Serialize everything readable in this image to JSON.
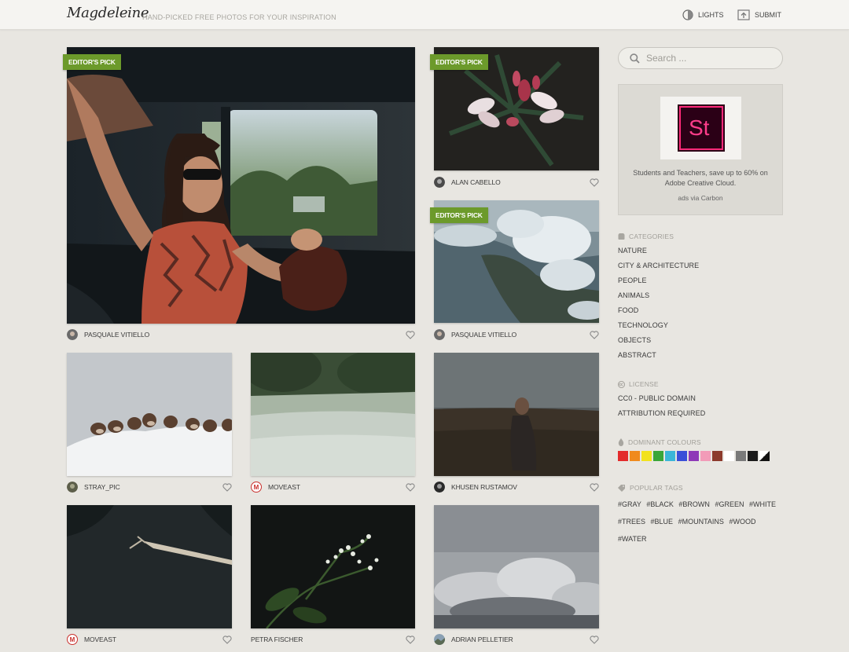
{
  "header": {
    "logo": "Magdeleine",
    "tagline": "HAND-PICKED FREE PHOTOS FOR YOUR INSPIRATION",
    "lights_label": "LIGHTS",
    "submit_label": "SUBMIT"
  },
  "photos": [
    {
      "author": "PASQUALE VITIELLO",
      "badge": "EDITOR'S PICK",
      "avatar": "photo-avatar"
    },
    {
      "author": "ALAN CABELLO",
      "badge": "EDITOR'S PICK",
      "avatar": "photo-avatar"
    },
    {
      "author": "PASQUALE VITIELLO",
      "badge": "EDITOR'S PICK",
      "avatar": "photo-avatar"
    },
    {
      "author": "STRAY_PIC",
      "avatar": "photo-avatar"
    },
    {
      "author": "MOVEAST",
      "avatar": "moveast-logo",
      "avatar_letter": "M"
    },
    {
      "author": "KHUSEN RUSTAMOV",
      "avatar": "photo-avatar"
    },
    {
      "author": "MOVEAST",
      "avatar": "moveast-logo",
      "avatar_letter": "M"
    },
    {
      "author": "PETRA FISCHER"
    },
    {
      "author": "ADRIAN PELLETIER",
      "avatar": "photo-avatar"
    }
  ],
  "sidebar": {
    "search_placeholder": "Search ...",
    "ad": {
      "logo_text": "St",
      "text": "Students and Teachers, save up to 60% on Adobe Creative Cloud.",
      "via": "ads via Carbon"
    },
    "categories": {
      "title": "CATEGORIES",
      "items": [
        "NATURE",
        "CITY & ARCHITECTURE",
        "PEOPLE",
        "ANIMALS",
        "FOOD",
        "TECHNOLOGY",
        "OBJECTS",
        "ABSTRACT"
      ]
    },
    "license": {
      "title": "LICENSE",
      "items": [
        "CC0 - PUBLIC DOMAIN",
        "ATTRIBUTION REQUIRED"
      ]
    },
    "colours": {
      "title": "DOMINANT COLOURS",
      "swatches": [
        "#e32b2b",
        "#f08a1c",
        "#f2e21e",
        "#3aa63a",
        "#3bb6d8",
        "#3a4fd8",
        "#8e3ab8",
        "#f29bb8",
        "#8c3a2c",
        "#ffffff",
        "#7a7a7a",
        "#1a1a1a",
        "bw"
      ]
    },
    "tags": {
      "title": "POPULAR TAGS",
      "items": [
        "#GRAY",
        "#BLACK",
        "#BROWN",
        "#GREEN",
        "#WHITE",
        "#TREES",
        "#BLUE",
        "#MOUNTAINS",
        "#WOOD",
        "#WATER"
      ]
    }
  },
  "colors": {
    "badge": "#6c9a2b",
    "background": "#e8e6e1"
  }
}
